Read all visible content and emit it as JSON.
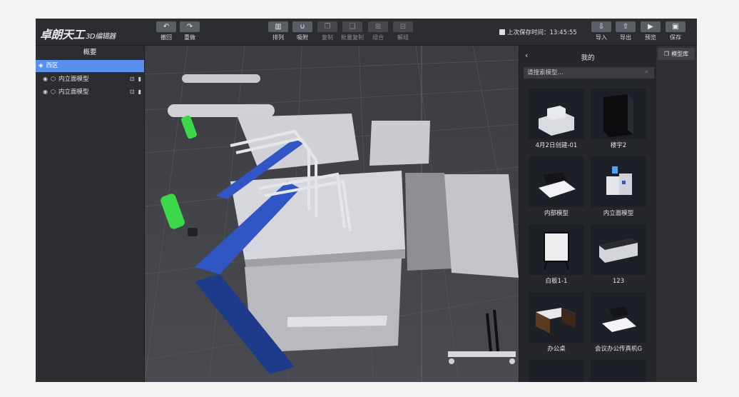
{
  "app": {
    "logo_main": "卓朗天工",
    "logo_sub": "3D编辑器"
  },
  "toolbar": {
    "undo": "撤回",
    "redo": "重做",
    "arrange": "排列",
    "snap": "吸附",
    "copy": "复制",
    "batch_copy": "批量复制",
    "group": "组合",
    "ungroup": "解组",
    "last_save_label": "上次保存时间：13:45:55",
    "import": "导入",
    "export": "导出",
    "preview": "预览",
    "save": "保存"
  },
  "outline": {
    "title": "概要",
    "region": "西区",
    "items": [
      {
        "label": "内立面模型"
      },
      {
        "label": "内立面模型"
      }
    ]
  },
  "library": {
    "title": "我的",
    "search_placeholder": "请搜索模型...",
    "tab_label": "模型库",
    "models": [
      {
        "name": "4月2日创建-01"
      },
      {
        "name": "楼宇2"
      },
      {
        "name": "内部模型"
      },
      {
        "name": "内立面模型"
      },
      {
        "name": "白板1-1"
      },
      {
        "name": "123"
      },
      {
        "name": "办公桌"
      },
      {
        "name": "会议办公传真机G"
      }
    ]
  },
  "colors": {
    "accent_blue": "#5a8ff0",
    "panel_bg": "#2c2d30",
    "viewport_bg": "#3a3b3f"
  }
}
